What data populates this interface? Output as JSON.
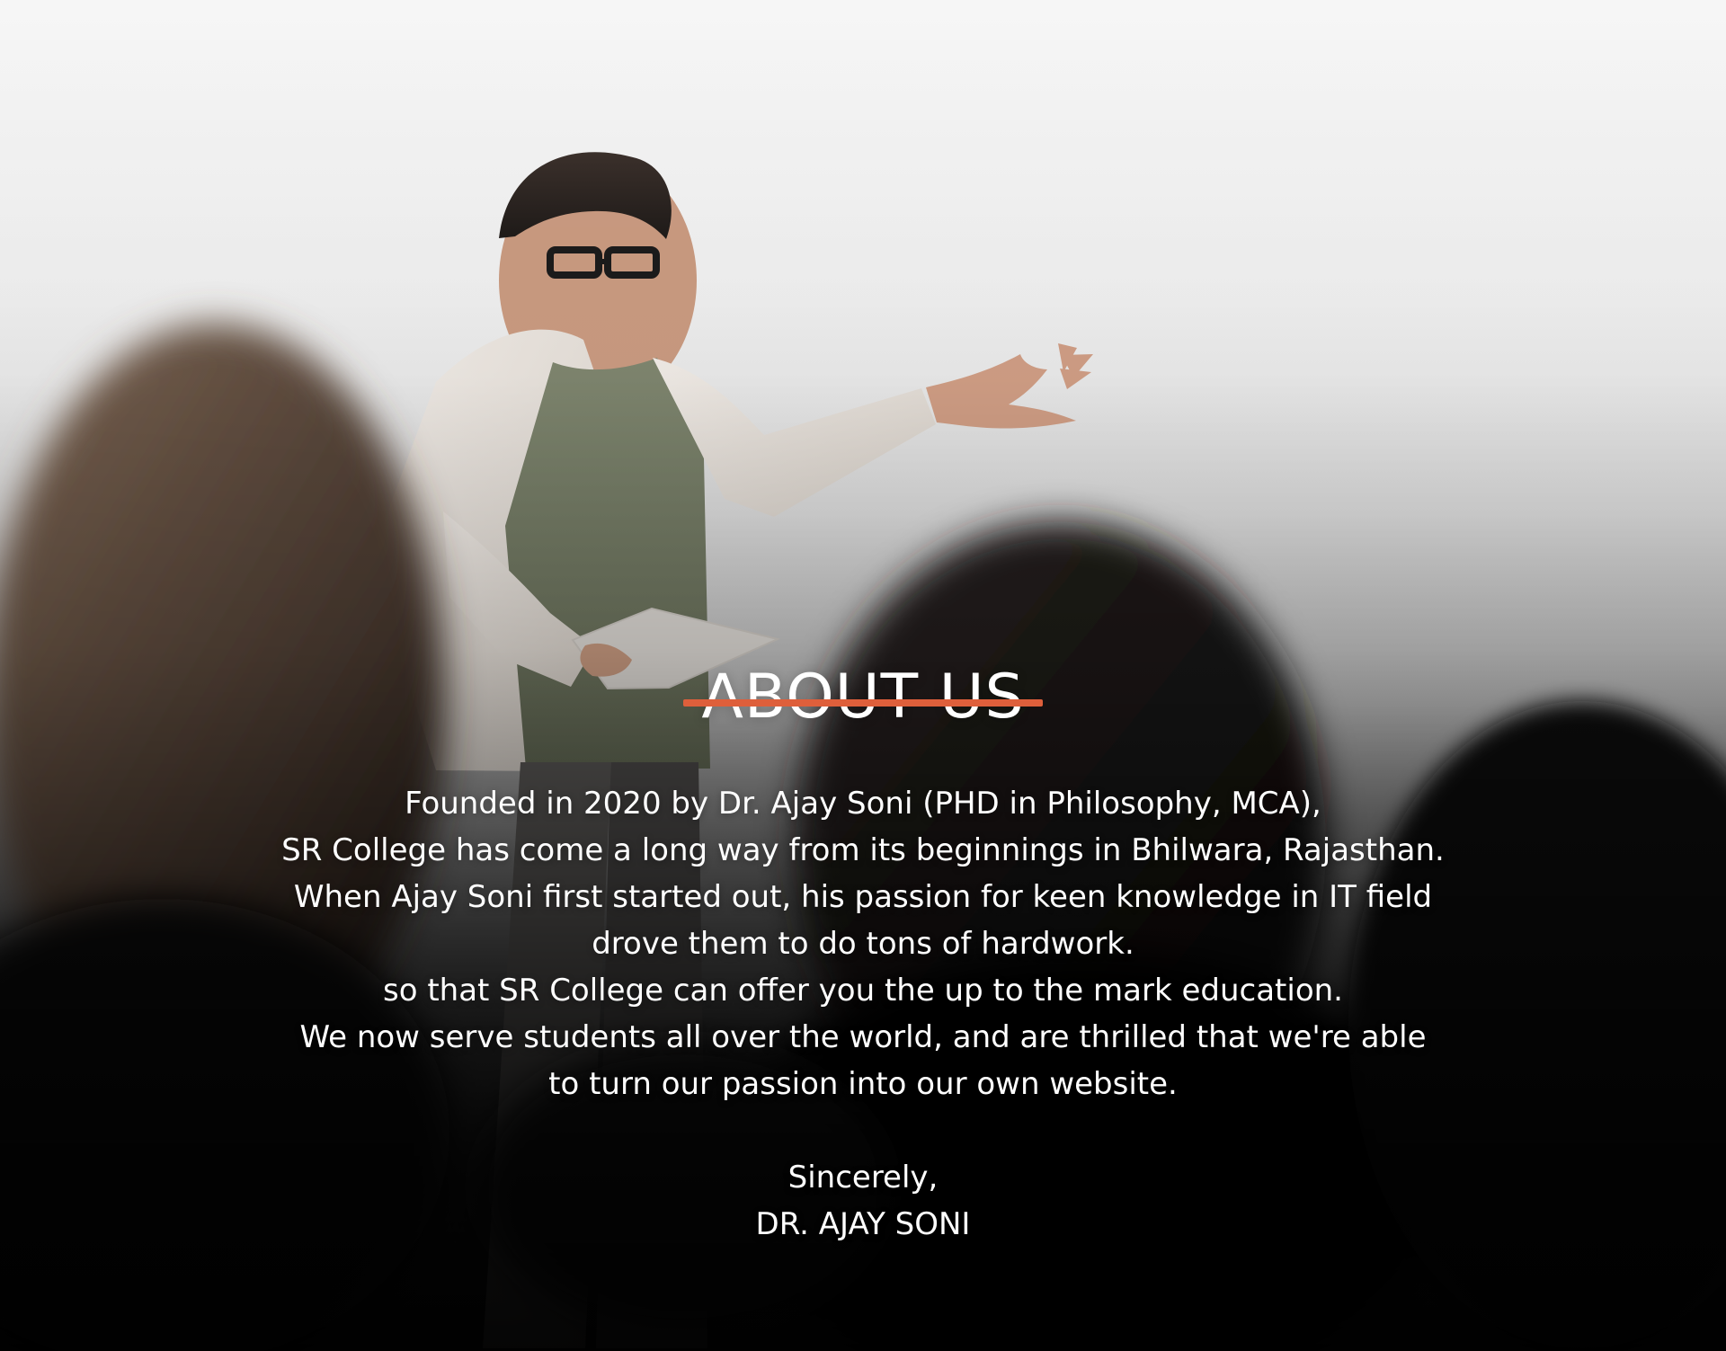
{
  "about": {
    "title": "ABOUT US",
    "accent_color": "#de5f3b",
    "paragraph_lines": [
      "Founded in 2020 by Dr. Ajay Soni (PHD in Philosophy, MCA),",
      "SR College has come a long way from its beginnings in Bhilwara, Rajasthan.",
      "When Ajay Soni first started out, his passion for keen knowledge in IT field",
      "drove them to do tons of hardwork.",
      "so that SR College can offer you the up to the mark education.",
      "We now serve students all over the world, and are thrilled that we're able",
      "to turn our passion into our own website."
    ],
    "signoff": {
      "closing": "Sincerely,",
      "name": "DR. AJAY SONI"
    }
  }
}
